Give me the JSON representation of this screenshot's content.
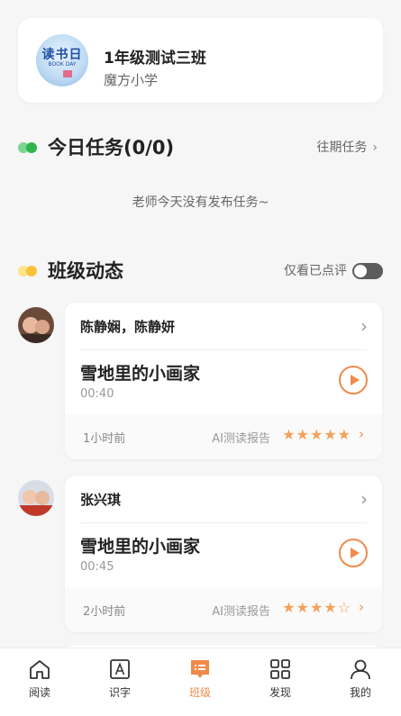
{
  "class_card": {
    "logo_text_cn": "读书日",
    "logo_text_en": "BOOK DAY",
    "class_name": "1年级测试三班",
    "school_name": "魔方小学"
  },
  "today_tasks": {
    "title": "今日任务(0/0)",
    "history_link": "往期任务",
    "empty_text": "老师今天没有发布任务~",
    "dot_colors": [
      "#7bd78f",
      "#2fb54c"
    ]
  },
  "class_feed": {
    "title": "班级动态",
    "filter_label": "仅看已点评",
    "filter_on": false,
    "dot_colors": [
      "#ffe28a",
      "#f8c23a"
    ],
    "posts": [
      {
        "names": "陈静娴，陈静妍",
        "work_title": "雪地里的小画家",
        "duration": "00:40",
        "time": "1小时前",
        "report_label": "AI测读报告",
        "stars": 5
      },
      {
        "names": "张兴琪",
        "work_title": "雪地里的小画家",
        "duration": "00:45",
        "time": "2小时前",
        "report_label": "AI测读报告",
        "stars": 4
      }
    ]
  },
  "tabbar": {
    "accent_color": "#f08a4b",
    "items": [
      {
        "label": "阅读",
        "icon": "home-icon",
        "active": false
      },
      {
        "label": "识字",
        "icon": "letter-a-icon",
        "active": false
      },
      {
        "label": "班级",
        "icon": "class-chat-icon",
        "active": true
      },
      {
        "label": "发现",
        "icon": "grid-icon",
        "active": false
      },
      {
        "label": "我的",
        "icon": "person-icon",
        "active": false
      }
    ]
  }
}
